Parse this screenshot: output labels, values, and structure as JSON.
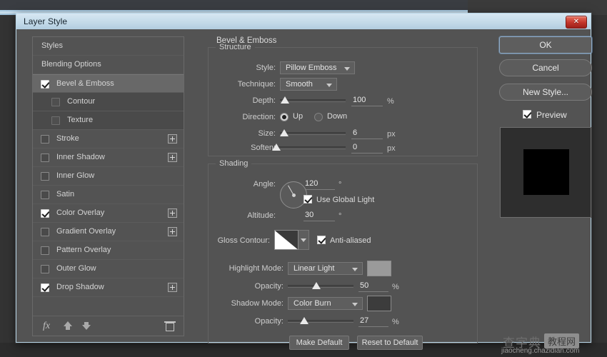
{
  "window": {
    "title": "Layer Style",
    "close_label": "✕"
  },
  "sidebar": {
    "items": [
      {
        "label": "Styles",
        "checkbox": "none",
        "indent": 0,
        "selected": false,
        "plus": false
      },
      {
        "label": "Blending Options",
        "checkbox": "none",
        "indent": 0,
        "selected": false,
        "plus": false
      },
      {
        "label": "Bevel & Emboss",
        "checkbox": "checked",
        "indent": 0,
        "selected": true,
        "plus": false
      },
      {
        "label": "Contour",
        "checkbox": "unchecked",
        "indent": 1,
        "selected": false,
        "plus": false
      },
      {
        "label": "Texture",
        "checkbox": "unchecked",
        "indent": 1,
        "selected": false,
        "plus": false
      },
      {
        "label": "Stroke",
        "checkbox": "unchecked",
        "indent": 0,
        "selected": false,
        "plus": true
      },
      {
        "label": "Inner Shadow",
        "checkbox": "unchecked",
        "indent": 0,
        "selected": false,
        "plus": true
      },
      {
        "label": "Inner Glow",
        "checkbox": "unchecked",
        "indent": 0,
        "selected": false,
        "plus": false
      },
      {
        "label": "Satin",
        "checkbox": "unchecked",
        "indent": 0,
        "selected": false,
        "plus": false
      },
      {
        "label": "Color Overlay",
        "checkbox": "checked",
        "indent": 0,
        "selected": false,
        "plus": true
      },
      {
        "label": "Gradient Overlay",
        "checkbox": "unchecked",
        "indent": 0,
        "selected": false,
        "plus": true
      },
      {
        "label": "Pattern Overlay",
        "checkbox": "unchecked",
        "indent": 0,
        "selected": false,
        "plus": false
      },
      {
        "label": "Outer Glow",
        "checkbox": "unchecked",
        "indent": 0,
        "selected": false,
        "plus": false
      },
      {
        "label": "Drop Shadow",
        "checkbox": "checked",
        "indent": 0,
        "selected": false,
        "plus": true
      }
    ],
    "footer_icons": [
      "fx-icon",
      "arrow-up-icon",
      "arrow-down-icon",
      "trash-icon"
    ],
    "fx_glyph": "fx"
  },
  "panel": {
    "title": "Bevel & Emboss",
    "structure": {
      "legend": "Structure",
      "style_label": "Style:",
      "style_value": "Pillow Emboss",
      "technique_label": "Technique:",
      "technique_value": "Smooth",
      "depth_label": "Depth:",
      "depth_value": "100",
      "depth_unit": "%",
      "depth_percent": 8,
      "direction_label": "Direction:",
      "direction_up_label": "Up",
      "direction_down_label": "Down",
      "direction_selected": "Up",
      "size_label": "Size:",
      "size_value": "6",
      "size_unit": "px",
      "size_percent": 7,
      "soften_label": "Soften:",
      "soften_value": "0",
      "soften_unit": "px",
      "soften_percent": 1
    },
    "shading": {
      "legend": "Shading",
      "angle_label": "Angle:",
      "angle_value": "120",
      "angle_unit": "°",
      "angle_degrees": 120,
      "use_global_light_label": "Use Global Light",
      "use_global_light_checked": true,
      "altitude_label": "Altitude:",
      "altitude_value": "30",
      "altitude_unit": "°",
      "gloss_contour_label": "Gloss Contour:",
      "anti_aliased_label": "Anti-aliased",
      "anti_aliased_checked": true,
      "highlight_mode_label": "Highlight Mode:",
      "highlight_mode_value": "Linear Light",
      "highlight_color": "#9a9a9a",
      "highlight_opacity_label": "Opacity:",
      "highlight_opacity_value": "50",
      "highlight_opacity_unit": "%",
      "highlight_opacity_percent": 43,
      "shadow_mode_label": "Shadow Mode:",
      "shadow_mode_value": "Color Burn",
      "shadow_color": "#3c3c3c",
      "shadow_opacity_label": "Opacity:",
      "shadow_opacity_value": "27",
      "shadow_opacity_unit": "%",
      "shadow_opacity_percent": 25
    },
    "make_default_label": "Make Default",
    "reset_default_label": "Reset to Default"
  },
  "actions": {
    "ok_label": "OK",
    "cancel_label": "Cancel",
    "new_style_label": "New Style...",
    "preview_label": "Preview",
    "preview_checked": true
  },
  "watermark": {
    "cn_text": "查字典",
    "badge_text": "教程网",
    "url": "jiaocheng.chazidian.com"
  }
}
